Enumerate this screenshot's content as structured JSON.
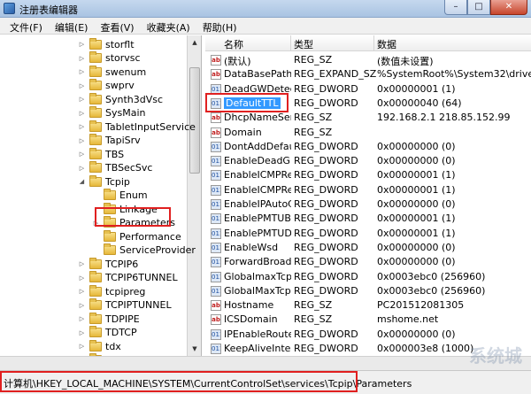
{
  "window": {
    "title": "注册表编辑器",
    "min": "–",
    "max": "□",
    "close": "✕"
  },
  "menu": [
    "文件(F)",
    "编辑(E)",
    "查看(V)",
    "收藏夹(A)",
    "帮助(H)"
  ],
  "tree": [
    {
      "label": "storflt",
      "level": 0,
      "exp": "▷"
    },
    {
      "label": "storvsc",
      "level": 0,
      "exp": "▷"
    },
    {
      "label": "swenum",
      "level": 0,
      "exp": "▷"
    },
    {
      "label": "swprv",
      "level": 0,
      "exp": "▷"
    },
    {
      "label": "Synth3dVsc",
      "level": 0,
      "exp": "▷"
    },
    {
      "label": "SysMain",
      "level": 0,
      "exp": "▷"
    },
    {
      "label": "TabletInputService",
      "level": 0,
      "exp": "▷"
    },
    {
      "label": "TapiSrv",
      "level": 0,
      "exp": "▷"
    },
    {
      "label": "TBS",
      "level": 0,
      "exp": "▷"
    },
    {
      "label": "TBSecSvc",
      "level": 0,
      "exp": "▷"
    },
    {
      "label": "Tcpip",
      "level": 0,
      "exp": "◢"
    },
    {
      "label": "Enum",
      "level": 1,
      "exp": ""
    },
    {
      "label": "Linkage",
      "level": 1,
      "exp": ""
    },
    {
      "label": "Parameters",
      "level": 1,
      "exp": "▷"
    },
    {
      "label": "Performance",
      "level": 1,
      "exp": ""
    },
    {
      "label": "ServiceProvider",
      "level": 1,
      "exp": ""
    },
    {
      "label": "TCPIP6",
      "level": 0,
      "exp": "▷"
    },
    {
      "label": "TCPIP6TUNNEL",
      "level": 0,
      "exp": "▷"
    },
    {
      "label": "tcpipreg",
      "level": 0,
      "exp": "▷"
    },
    {
      "label": "TCPIPTUNNEL",
      "level": 0,
      "exp": "▷"
    },
    {
      "label": "TDPIPE",
      "level": 0,
      "exp": "▷"
    },
    {
      "label": "TDTCP",
      "level": 0,
      "exp": "▷"
    },
    {
      "label": "tdx",
      "level": 0,
      "exp": "▷"
    },
    {
      "label": "TermCommProtect",
      "level": 0,
      "exp": "▷"
    }
  ],
  "columns": {
    "name": "名称",
    "type": "类型",
    "data": "数据"
  },
  "values": [
    {
      "icon": "ab",
      "name": "(默认)",
      "type": "REG_SZ",
      "data": "(数值未设置)"
    },
    {
      "icon": "ab",
      "name": "DataBasePath",
      "type": "REG_EXPAND_SZ",
      "data": "%SystemRoot%\\System32\\drivers\\"
    },
    {
      "icon": "011",
      "name": "DeadGWDetec...",
      "type": "REG_DWORD",
      "data": "0x00000001 (1)"
    },
    {
      "icon": "011",
      "name": "DefaultTTL",
      "type": "REG_DWORD",
      "data": "0x00000040 (64)"
    },
    {
      "icon": "ab",
      "name": "DhcpNameSer...",
      "type": "REG_SZ",
      "data": "192.168.2.1 218.85.152.99"
    },
    {
      "icon": "ab",
      "name": "Domain",
      "type": "REG_SZ",
      "data": ""
    },
    {
      "icon": "011",
      "name": "DontAddDefau...",
      "type": "REG_DWORD",
      "data": "0x00000000 (0)"
    },
    {
      "icon": "011",
      "name": "EnableDeadG...",
      "type": "REG_DWORD",
      "data": "0x00000000 (0)"
    },
    {
      "icon": "011",
      "name": "EnableICMPRe...",
      "type": "REG_DWORD",
      "data": "0x00000001 (1)"
    },
    {
      "icon": "011",
      "name": "EnableICMPRe...",
      "type": "REG_DWORD",
      "data": "0x00000001 (1)"
    },
    {
      "icon": "011",
      "name": "EnableIPAutoC...",
      "type": "REG_DWORD",
      "data": "0x00000000 (0)"
    },
    {
      "icon": "011",
      "name": "EnablePMTUB...",
      "type": "REG_DWORD",
      "data": "0x00000001 (1)"
    },
    {
      "icon": "011",
      "name": "EnablePMTUDi...",
      "type": "REG_DWORD",
      "data": "0x00000001 (1)"
    },
    {
      "icon": "011",
      "name": "EnableWsd",
      "type": "REG_DWORD",
      "data": "0x00000000 (0)"
    },
    {
      "icon": "011",
      "name": "ForwardBroad...",
      "type": "REG_DWORD",
      "data": "0x00000000 (0)"
    },
    {
      "icon": "011",
      "name": "GlobalmaxTcp...",
      "type": "REG_DWORD",
      "data": "0x0003ebc0 (256960)"
    },
    {
      "icon": "011",
      "name": "GlobalMaxTcp...",
      "type": "REG_DWORD",
      "data": "0x0003ebc0 (256960)"
    },
    {
      "icon": "ab",
      "name": "Hostname",
      "type": "REG_SZ",
      "data": "PC201512081305"
    },
    {
      "icon": "ab",
      "name": "ICSDomain",
      "type": "REG_SZ",
      "data": "mshome.net"
    },
    {
      "icon": "011",
      "name": "IPEnableRouter",
      "type": "REG_DWORD",
      "data": "0x00000000 (0)"
    },
    {
      "icon": "011",
      "name": "KeepAliveInter...",
      "type": "REG_DWORD",
      "data": "0x000003e8 (1000)"
    },
    {
      "icon": "011",
      "name": "KeepAliveTime",
      "type": "REG_DWORD",
      "data": "0x006ddd00 (7200000)"
    }
  ],
  "status": {
    "path": "计算机\\HKEY_LOCAL_MACHINE\\SYSTEM\\CurrentControlSet\\services\\Tcpip\\Parameters"
  },
  "watermark": "系统城"
}
